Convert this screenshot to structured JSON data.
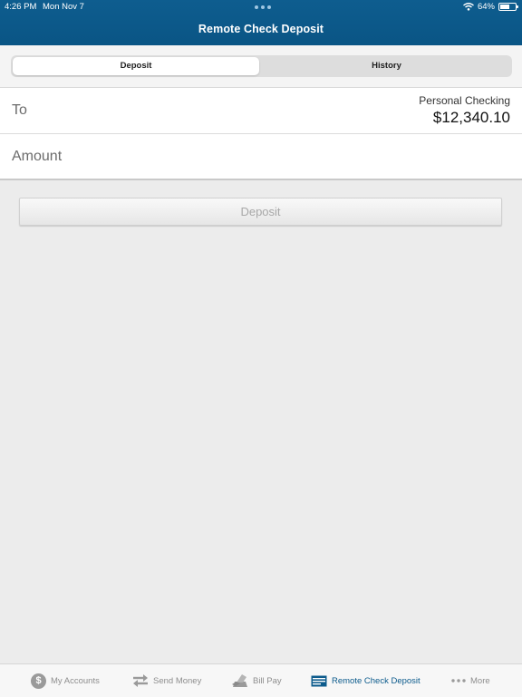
{
  "status": {
    "time": "4:26 PM",
    "date": "Mon Nov 7",
    "battery": "64%",
    "battery_level": 0.64
  },
  "header": {
    "title": "Remote Check Deposit"
  },
  "segments": {
    "active": "Deposit",
    "inactive": "History"
  },
  "form": {
    "to_label": "To",
    "account_name": "Personal Checking",
    "account_balance": "$12,340.10",
    "amount_label": "Amount",
    "amount_value": ""
  },
  "deposit_button": "Deposit",
  "tabbar": {
    "items": [
      {
        "label": "My Accounts",
        "icon": "dollar-circle-icon"
      },
      {
        "label": "Send Money",
        "icon": "transfer-arrows-icon"
      },
      {
        "label": "Bill Pay",
        "icon": "bill-pay-icon"
      },
      {
        "label": "Remote Check Deposit",
        "icon": "check-deposit-icon",
        "active": true
      },
      {
        "label": "More",
        "icon": "more-dots-icon"
      }
    ]
  },
  "colors": {
    "brand": "#0c5b8c",
    "background": "#ececec"
  }
}
